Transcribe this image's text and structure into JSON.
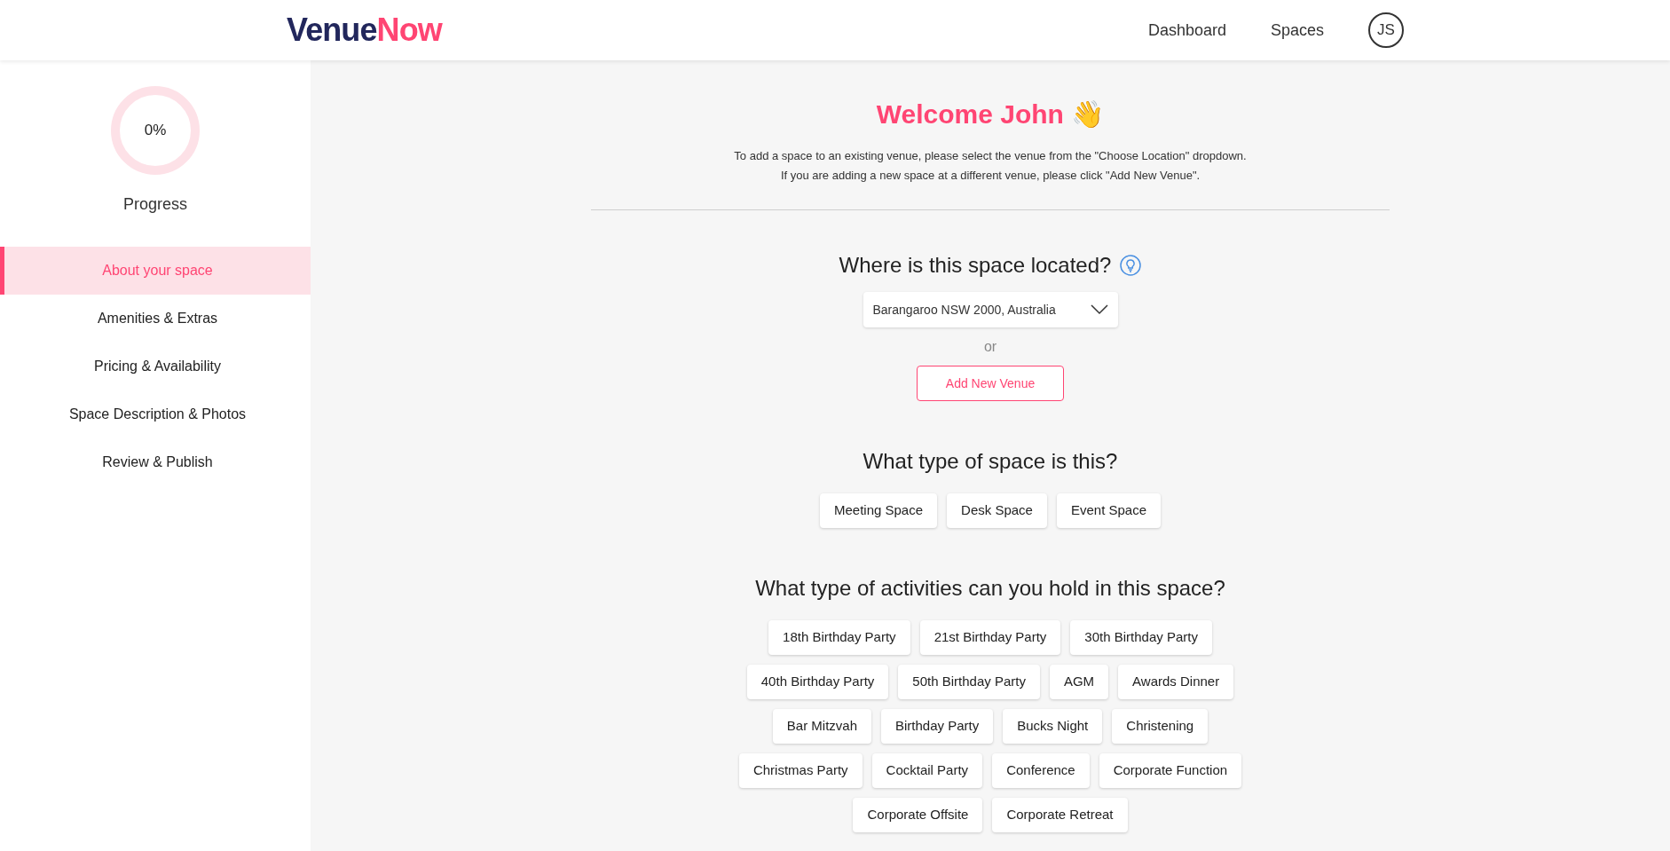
{
  "header": {
    "logo": {
      "part_1": "Venue",
      "part_2": "Now"
    },
    "nav": [
      "Dashboard",
      "Spaces"
    ],
    "avatar": "JS"
  },
  "sidebar": {
    "progress": {
      "reading": "0%",
      "level": 0,
      "label": "Progress"
    },
    "steps": [
      {
        "label": "About your space",
        "selected": true
      },
      {
        "label": "Amenities & Extras",
        "selected": false
      },
      {
        "label": "Pricing & Availability",
        "selected": false
      },
      {
        "label": "Space Description & Photos",
        "selected": false
      },
      {
        "label": "Review & Publish",
        "selected": false
      }
    ]
  },
  "main": {
    "title": "Welcome John",
    "title_emoji": "👋",
    "intro": [
      "To add a space to an existing venue, please select the venue from the \"Choose Location\" dropdown.",
      "If you are adding a new space at a different venue, please click \"Add New Venue\"."
    ],
    "location": {
      "heading": "Where is this space located?",
      "value": "Barangaroo NSW 2000, Australia",
      "or": "or",
      "add_button": "Add New Venue"
    },
    "space_type": {
      "heading": "What type of space is this?",
      "options": [
        {
          "label": "Meeting Space",
          "selected": false
        },
        {
          "label": "Desk Space",
          "selected": false
        },
        {
          "label": "Event Space",
          "selected": false
        }
      ]
    },
    "activities": {
      "heading": "What type of activities can you hold in this space?",
      "options": [
        {
          "label": "18th Birthday Party",
          "selected": false
        },
        {
          "label": "21st Birthday Party",
          "selected": false
        },
        {
          "label": "30th Birthday Party",
          "selected": false
        },
        {
          "label": "40th Birthday Party",
          "selected": false
        },
        {
          "label": "50th Birthday Party",
          "selected": false
        },
        {
          "label": "AGM",
          "selected": false
        },
        {
          "label": "Awards Dinner",
          "selected": false
        },
        {
          "label": "Bar Mitzvah",
          "selected": false
        },
        {
          "label": "Birthday Party",
          "selected": false
        },
        {
          "label": "Bucks Night",
          "selected": false
        },
        {
          "label": "Christening",
          "selected": false
        },
        {
          "label": "Christmas Party",
          "selected": false
        },
        {
          "label": "Cocktail Party",
          "selected": false
        },
        {
          "label": "Conference",
          "selected": false
        },
        {
          "label": "Corporate Function",
          "selected": false
        },
        {
          "label": "Corporate Offsite",
          "selected": false
        },
        {
          "label": "Corporate Retreat",
          "selected": false
        }
      ]
    }
  }
}
